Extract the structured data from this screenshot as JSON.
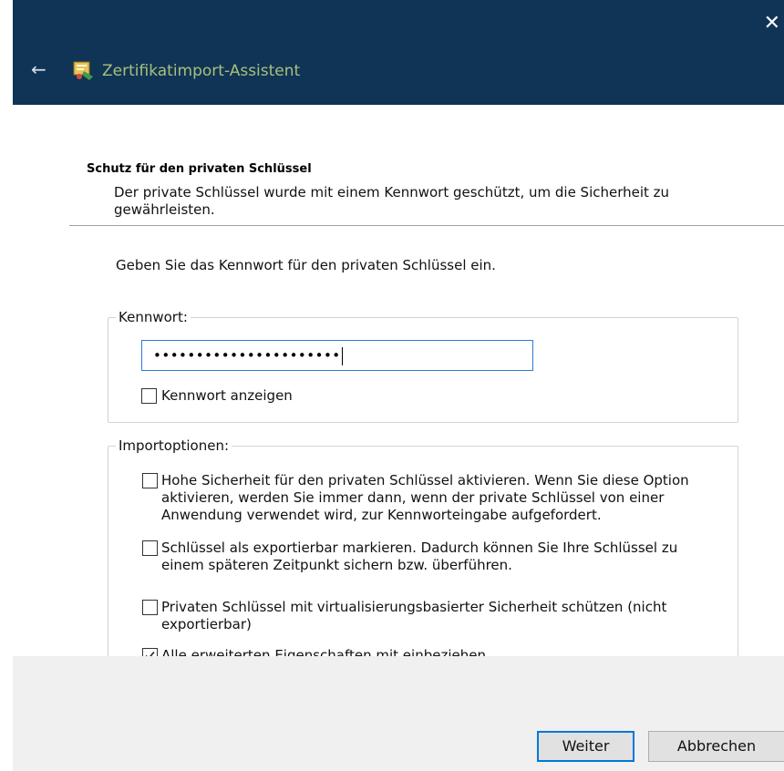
{
  "window": {
    "close_glyph": "✕",
    "back_glyph": "←",
    "app_icon": "certificate-wizard-icon",
    "title": "Zertifikatimport-Assistent"
  },
  "section": {
    "title": "Schutz für den privaten Schlüssel",
    "description": "Der private Schlüssel wurde mit einem Kennwort geschützt, um die Sicherheit zu gewährleisten."
  },
  "prompt": "Geben Sie das Kennwort für den privaten Schlüssel ein.",
  "password_group": {
    "legend": "Kennwort:",
    "value": "••••••••••••••••••••••",
    "show_password": {
      "label": "Kennwort anzeigen",
      "checked": false
    }
  },
  "import_options": {
    "legend": "Importoptionen:",
    "options": [
      {
        "label": "Hohe Sicherheit für den privaten Schlüssel aktivieren. Wenn Sie diese Option aktivieren, werden Sie immer dann, wenn der private Schlüssel von einer Anwendung verwendet wird, zur Kennworteingabe aufgefordert.",
        "checked": false
      },
      {
        "label": "Schlüssel als exportierbar markieren. Dadurch können Sie Ihre Schlüssel zu einem späteren Zeitpunkt sichern bzw. überführen.",
        "checked": false
      },
      {
        "label": "Privaten Schlüssel mit virtualisierungsbasierter Sicherheit schützen (nicht exportierbar)",
        "checked": false
      },
      {
        "label": "Alle erweiterten Eigenschaften mit einbeziehen",
        "checked": true
      }
    ]
  },
  "buttons": {
    "next": "Weiter",
    "cancel": "Abbrechen"
  },
  "colors": {
    "titlebar": "#0f3456",
    "title_text": "#a9c07a",
    "accent": "#0078d7"
  }
}
